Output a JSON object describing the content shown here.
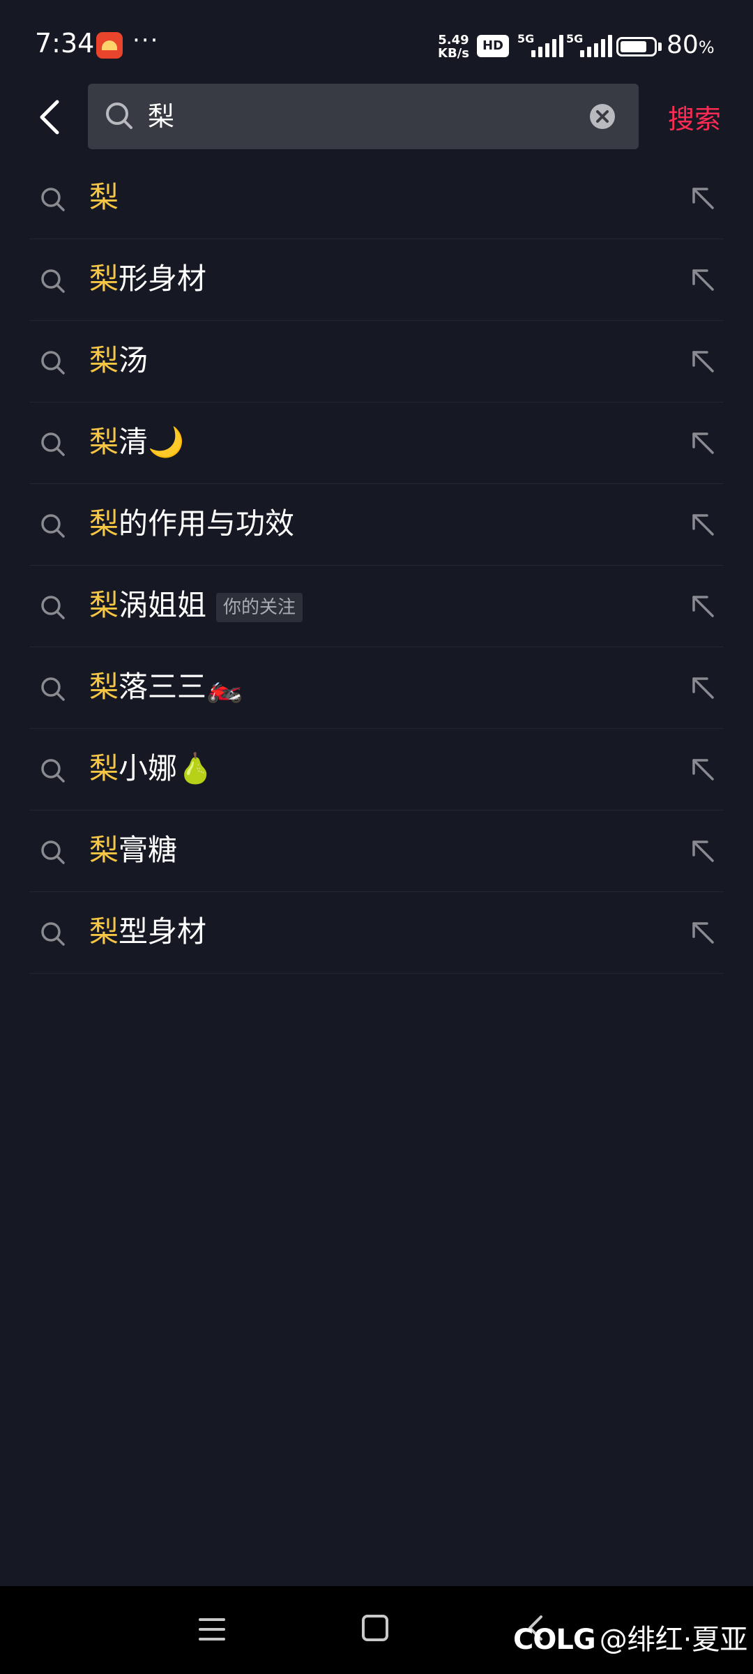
{
  "status_bar": {
    "time": "7:34",
    "dots": "···",
    "net_speed_value": "5.49",
    "net_speed_unit": "KB/s",
    "hd_label": "HD",
    "sim1_label": "5G",
    "sim2_label": "5G",
    "battery_level": 80,
    "battery_value": "80",
    "battery_unit": "%"
  },
  "search": {
    "query": "梨",
    "search_label": "搜索"
  },
  "suggestions": [
    {
      "highlight": "梨",
      "rest": ""
    },
    {
      "highlight": "梨",
      "rest": "形身材"
    },
    {
      "highlight": "梨",
      "rest": "汤"
    },
    {
      "highlight": "梨",
      "rest": "清🌙"
    },
    {
      "highlight": "梨",
      "rest": "的作用与功效"
    },
    {
      "highlight": "梨",
      "rest": "涡姐姐",
      "tag": "你的关注"
    },
    {
      "highlight": "梨",
      "rest": "落三三🏍️"
    },
    {
      "highlight": "梨",
      "rest": "小娜🍐"
    },
    {
      "highlight": "梨",
      "rest": "膏糖"
    },
    {
      "highlight": "梨",
      "rest": "型身材"
    }
  ],
  "watermark": {
    "logo": "COLG",
    "text": "@绯红·夏亚"
  },
  "colors": {
    "background": "#161823",
    "highlight": "#f7c744",
    "accent": "#fe2c55",
    "search_box": "#393b44"
  }
}
